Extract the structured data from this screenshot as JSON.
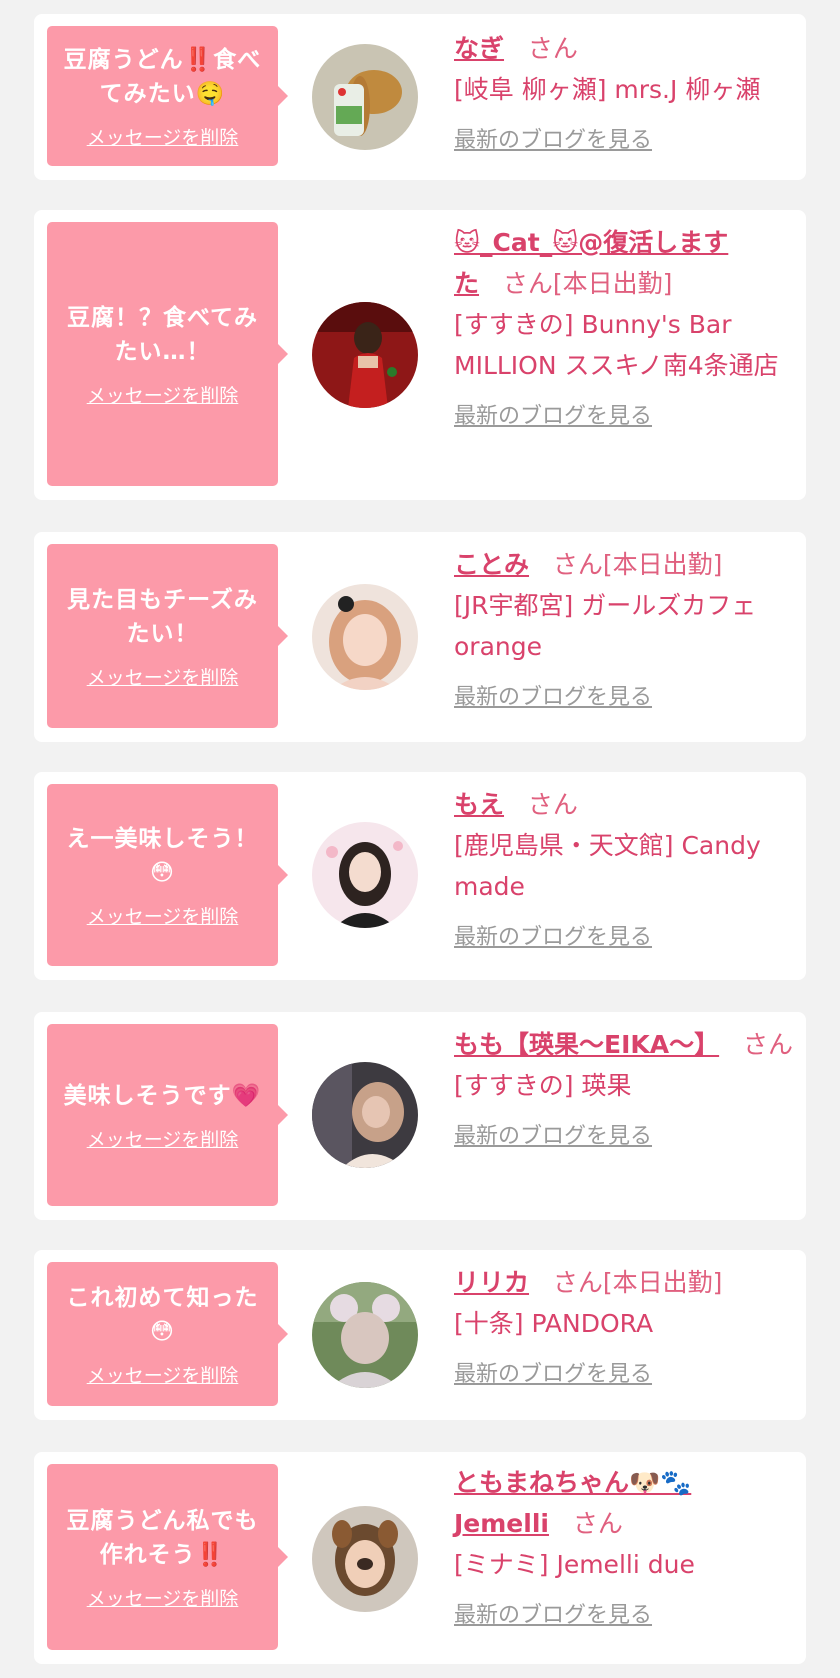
{
  "delete_label": "メッセージを削除",
  "blog_label": "最新のブログを見る",
  "colors": {
    "background": "#f2f2f2",
    "bubble": "#fc9aa9",
    "accent": "#d9426b",
    "link_gray": "#9a9a9a"
  },
  "cards": [
    {
      "comment_lines": [
        "豆腐うどん‼️食べ",
        "てみたい🤤"
      ],
      "name_lines": [
        "なぎ"
      ],
      "san": "さん",
      "status": "",
      "shop": "[岐阜 柳ヶ瀬] mrs.J 柳ヶ瀬",
      "avatar": "dog-illustration"
    },
    {
      "comment_lines": [
        "豆腐！？食べてみ",
        "たい…！"
      ],
      "name_lines": [
        "🐱_Cat_🐱@復活します",
        "た"
      ],
      "san": "さん",
      "status": "[本日出勤]",
      "shop": "[すすきの] Bunny's Bar MILLION ススキノ南4条通店",
      "avatar": "red-dress-photo"
    },
    {
      "comment_lines": [
        "見た目もチーズみ",
        "たい！"
      ],
      "name_lines": [
        "ことみ"
      ],
      "san": "さん",
      "status": "[本日出勤]",
      "shop": "[JR宇都宮] ガールズカフェorange",
      "avatar": "portrait-photo"
    },
    {
      "comment_lines": [
        "え一美味しそう！",
        "😳"
      ],
      "name_lines": [
        "もえ"
      ],
      "san": "さん",
      "status": "",
      "shop": "[鹿児島県・天文館] Candy made",
      "avatar": "portrait-photo"
    },
    {
      "comment_lines": [
        "美味しそうです💗"
      ],
      "name_lines": [
        "もも【瑛果〜EIKA〜】"
      ],
      "san": "さん",
      "status": "",
      "shop": "[すすきの] 瑛果",
      "avatar": "blurred-photo"
    },
    {
      "comment_lines": [
        "これ初めて知った",
        "😳"
      ],
      "name_lines": [
        "リリカ"
      ],
      "san": "さん",
      "status": "[本日出勤]",
      "shop": "[十条] PANDORA",
      "avatar": "portrait-photo"
    },
    {
      "comment_lines": [
        "豆腐うどん私でも",
        "作れそう‼️"
      ],
      "name_lines": [
        "ともまねちゃん🐶🐾",
        "Jemelli"
      ],
      "san": "さん",
      "status": "",
      "shop": "[ミナミ] Jemelli due",
      "avatar": "dog-filter-photo"
    }
  ]
}
